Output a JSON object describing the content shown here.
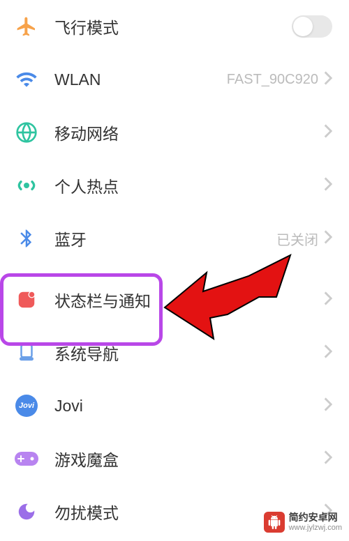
{
  "settings": {
    "airplane": {
      "label": "飞行模式"
    },
    "wlan": {
      "label": "WLAN",
      "value": "FAST_90C920"
    },
    "mobile_network": {
      "label": "移动网络"
    },
    "hotspot": {
      "label": "个人热点"
    },
    "bluetooth": {
      "label": "蓝牙",
      "value": "已关闭"
    },
    "statusbar": {
      "label": "状态栏与通知"
    },
    "navigation": {
      "label": "系统导航"
    },
    "jovi": {
      "label": "Jovi",
      "badge": "Jovi"
    },
    "gamebox": {
      "label": "游戏魔盒"
    },
    "dnd": {
      "label": "勿扰模式"
    }
  },
  "watermark": {
    "title": "简约安卓网",
    "url": "www.jylzwj.com"
  },
  "colors": {
    "airplane": "#f7a24a",
    "wlan": "#4a8ae8",
    "mobile": "#2ec4a0",
    "hotspot": "#2ec4a0",
    "bluetooth": "#4a8ae8",
    "statusbar": "#ef5a5a",
    "navigation": "#6a9fe8",
    "jovi": "#4a8ae8",
    "gamebox": "#b884f0",
    "dnd": "#9b6ee8",
    "highlight": "#b947e8",
    "arrow": "#e31212"
  }
}
